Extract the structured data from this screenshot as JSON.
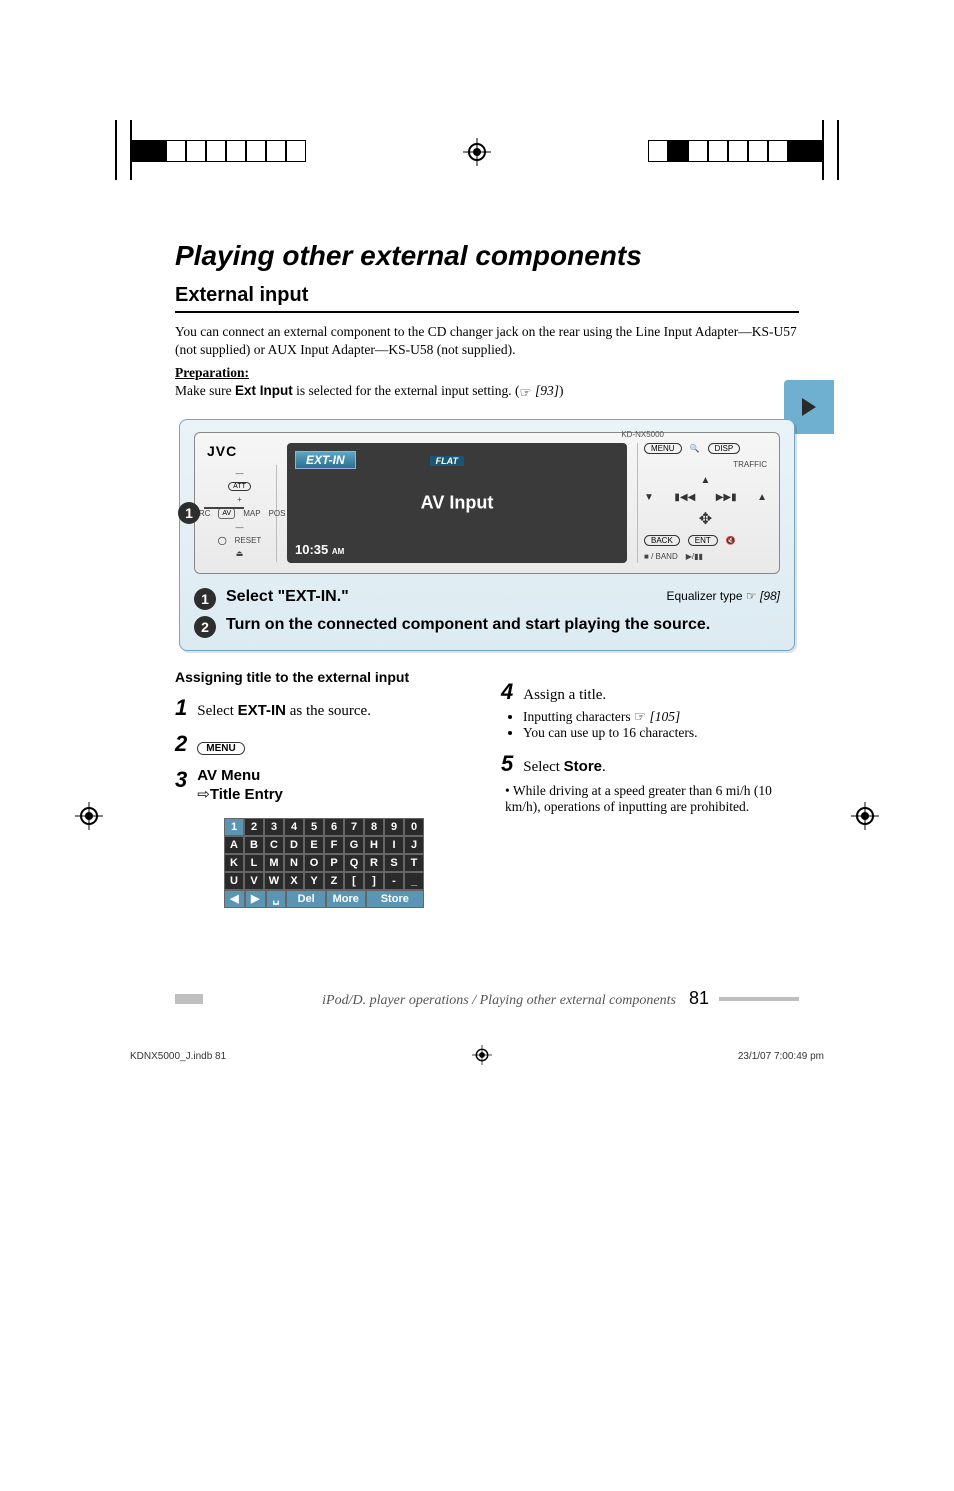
{
  "section_title": "Playing other external components",
  "sub_title": "External input",
  "intro_text": "You can connect an external component to the CD changer jack on the rear using the Line Input Adapter—KS-U57 (not supplied) or AUX Input Adapter—KS-U58 (not supplied).",
  "preparation_label": "Preparation:",
  "make_sure_prefix": "Make sure ",
  "make_sure_bold": "Ext Input",
  "make_sure_mid": " is selected for the external input setting. (",
  "make_sure_ref": "[93]",
  "make_sure_suffix": ")",
  "device": {
    "brand": "JVC",
    "model": "KD-NX5000",
    "screen_badge": "EXT-IN",
    "screen_flat": "FLAT",
    "screen_center": "AV Input",
    "screen_time": "10:35",
    "screen_ampm": "AM",
    "left": {
      "att": "ATT",
      "src": "SRC",
      "av": "AV",
      "map": "MAP",
      "pos": "POS",
      "reset": "RESET"
    },
    "right": {
      "menu": "MENU",
      "disp": "DISP",
      "traffic": "TRAFFIC",
      "back": "BACK",
      "ent": "ENT",
      "band": "/ BAND"
    }
  },
  "bluebox": {
    "step1_num": "1",
    "step1_text": "Select \"EXT-IN.\"",
    "eq_prefix": "Equalizer type ",
    "eq_ref": "[98]",
    "step2_num": "2",
    "step2_text": "Turn on the connected component and start playing the source."
  },
  "left_col": {
    "heading": "Assigning title to the external input",
    "s1_num": "1",
    "s1_prefix": "Select ",
    "s1_bold": "EXT-IN",
    "s1_suffix": " as the source.",
    "s2_num": "2",
    "s2_pill": "MENU",
    "s3_num": "3",
    "s3_bold1": "AV Menu",
    "s3_arrow": "⇨",
    "s3_bold2": "Title Entry"
  },
  "keypad": {
    "rows": [
      [
        "1",
        "2",
        "3",
        "4",
        "5",
        "6",
        "7",
        "8",
        "9",
        "0"
      ],
      [
        "A",
        "B",
        "C",
        "D",
        "E",
        "F",
        "G",
        "H",
        "I",
        "J"
      ],
      [
        "K",
        "L",
        "M",
        "N",
        "O",
        "P",
        "Q",
        "R",
        "S",
        "T"
      ],
      [
        "U",
        "V",
        "W",
        "X",
        "Y",
        "Z",
        "[",
        "]",
        "-",
        "_"
      ]
    ],
    "bottom": [
      "◀",
      "▶",
      "␣",
      "Del",
      "More",
      "Store"
    ]
  },
  "right_col": {
    "s4_num": "4",
    "s4_text": "Assign a title.",
    "s4_b1_prefix": "Inputting characters ",
    "s4_b1_ref": "[105]",
    "s4_b2": "You can use up to 16 characters.",
    "s5_num": "5",
    "s5_prefix": "Select ",
    "s5_bold": "Store",
    "s5_suffix": ".",
    "note": "While driving at a speed greater than 6 mi/h (10 km/h), operations of inputting are prohibited."
  },
  "footer": {
    "text": "iPod/D. player operations / Playing other external components",
    "page": "81"
  },
  "print": {
    "left": "KDNX5000_J.indb   81",
    "right": "23/1/07   7:00:49 pm"
  }
}
